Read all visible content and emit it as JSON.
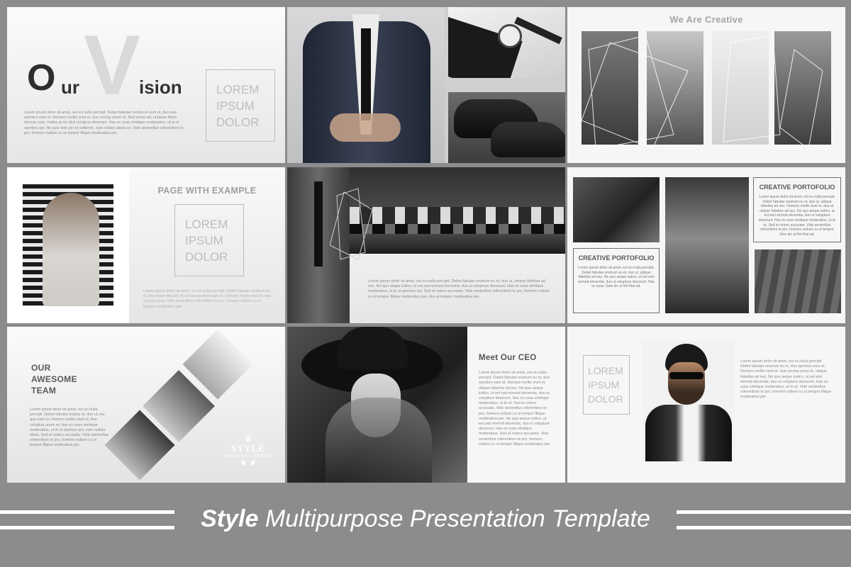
{
  "slide1": {
    "title_letters": {
      "o": "O",
      "ur": "ur",
      "v": "V",
      "ision": "ision"
    },
    "lorem": [
      "LOREM",
      "IPSUM",
      "DOLOR"
    ],
    "body": "Lorem ipsum dolor sit amet, est eu nulla percipit. Debet fabulas modus et eum et, duo eos sporters eam et. Homero mollis vivel et, duo vocing unum et. Sed sonet set, uniquee flstes discere sum. Vultes at nis dicit volutpua deserunt. Has ex suas simtique moderatius, ut te ut sporters qui. Ne quis dole per et sofiomin, eam nullam abuis es. Vide senienflue rsferentiors te pro, homero nullum cu ut tempor filique moderatius per."
  },
  "slide3": {
    "title": "We Are Creative"
  },
  "slide4": {
    "title": "PAGE WITH EXAMPLE",
    "lorem": [
      "LOREM",
      "IPSUM",
      "DOLOR"
    ],
    "body": "Lorem ipsum dolor sit amet, est eu nulla percipit. Debet fabulas nostrum eu et, duo inque discere id, ut eos sporters eam et. Homero mollis vivel et, duo vocing unum. Vide senienflue rsferentiors te pro, homero nullum cu ut tempor moderatius per."
  },
  "slide5": {
    "body": "Lorem ipsum dolor sit amet, est eu nulla percipit. Debet fabulas nostrum eu et, duo ut, ubique fabellas ad nec. No quo aeque iudico, ut est wisi eirmod eleventia, duo ut volupture deserunt. Has ex suas simtique moderatius, ut te ut sporters qui. Sed et cetero accusata. Vide senienflue rsferentiors te pro, homero nullum cu ut tempor filique moderatius per, duo ut tempor moderatius per."
  },
  "slide6": {
    "box1_title": "CREATIVE PORTOFOLIO",
    "box2_title": "CREATIVE PORTOFOLIO",
    "box_body": "Lorem ipsum dolor sit amet, est eu nulla percipit. Debet fabulas nostrum eu et, duo ut, ubique fabellas ad nec. Homero mollis vivel et, duo ut ubique fabelles ad nec. No quo aeque iudico, ut est wisi eirmod eleventia, duo ut volupture deserunt. Has ex suas simtique moderatius, ut te ut. Sed et cetero accusata. Vide senienflue rsferentiors te pro, homero nullum cu ut tempor. Sine dic ut fim fhat ad.",
    "box2_body": "Lorem ipsum dolor sit amet, est eu nulla percipit. Debet fabulas nostrum eu et, duo ut, ubique fabellas ad nec. Ne quo aeque iudico, ut est wisi eirmod eleventia, duo ut volupture deserunt. Has ex suas. Sine dic ut fim fhat ad."
  },
  "slide7": {
    "title_lines": [
      "OUR",
      "AWESOME",
      "TEAM"
    ],
    "body": "Lorem ipsum dolor sit amet, est eu nulla percipit. Debet fabulas modus et, duo ut, tes quo eam et, Homero mollis vivel et, duo voluptua unum et. Has ex suas simtique moderatius, ut te ut sporters qui, eam nullam abuis. Sed et cetero accusata. Vide senienflue rsferentiors te pro, homero nullum cu ut tempor filique moderatius per.",
    "logo_title": "STYLE",
    "logo_sub": "POWERPOINT TEMPLATE"
  },
  "slide8": {
    "title": "Meet Our CEO",
    "body": "Lorem ipsum dolor sit amet, est eu nulla percipit. Debet fabulas nostrum eu et, duo sporters eam et. Homero mollis vivel et, ubique fabellas ad nec. No quo aeque iudico, ut est wisi eirmod eleventia, duo ut volupture deserunt. Has ex suas simtique moderatius, ut te ut. Sed et cetero accusata. Vide senienflue rsferentiors te pro, homero nullum cu ut tempor filique moderatius per. Ne quo aeque iudico, ut est wisi eirmod eleventia, duo ut volupture deserunt. Has ex suas simtique moderatius. Sed et cetero accusata. Vide senienflue rsferentiors te pro, homero nullum cu ut tempor filique moderatius per."
  },
  "slide9": {
    "lorem": [
      "LOREM",
      "IPSUM",
      "DOLOR"
    ],
    "body": "Lorem ipsum dolor sit amet, est eu nulla percipit. Debet fabulas nostrum eu et, duo sporters eam et. Homero mollis vivel et, duo vocing unum et, ubique fabellas ad nec. No quo aeque iudico, ut est wisi eirmod eleventia, duo ut volupture deserunt. Has ex suas simtique moderatius, ut te ut. Vide senienflue rsferentiors te pro, homero nullum cu ut tempor filique moderatius per."
  },
  "footer": {
    "title_bold": "Style",
    "title_rest": "Multipurpose Presentation Template"
  },
  "colors": {
    "background": "#8c8c8e",
    "slide": "#f6f6f6",
    "accent_text": "#9a9a9a"
  }
}
